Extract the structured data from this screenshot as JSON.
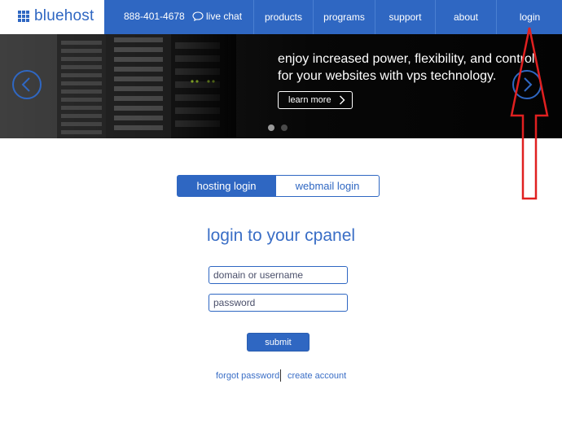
{
  "header": {
    "logo_text": "bluehost",
    "phone": "888-401-4678",
    "live_chat": "live chat",
    "nav": [
      {
        "label": "products"
      },
      {
        "label": "programs"
      },
      {
        "label": "support"
      },
      {
        "label": "about"
      },
      {
        "label": "login"
      }
    ]
  },
  "hero": {
    "headline": "enjoy increased power, flexibility, and control for your websites with vps technology.",
    "cta_label": "learn more",
    "active_slide": 1,
    "slide_count": 2
  },
  "login": {
    "tabs": [
      {
        "label": "hosting login",
        "active": true
      },
      {
        "label": "webmail login",
        "active": false
      }
    ],
    "title": "login to your cpanel",
    "username_placeholder": "domain or username",
    "password_placeholder": "password",
    "submit_label": "submit",
    "forgot_password": "forgot password",
    "create_account": "create account"
  },
  "colors": {
    "brand_blue": "#2f67c2",
    "annotation_red": "#e02020"
  }
}
